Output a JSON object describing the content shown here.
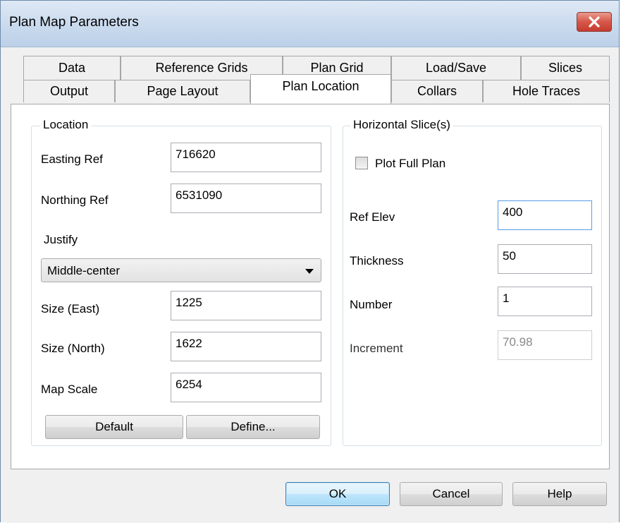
{
  "window": {
    "title": "Plan Map Parameters",
    "close_icon": "close-icon"
  },
  "tabs": {
    "row1": [
      "Data",
      "Reference Grids",
      "Plan Grid",
      "Load/Save",
      "Slices"
    ],
    "row2": [
      "Output",
      "Page Layout",
      "Plan Location",
      "Collars",
      "Hole Traces"
    ],
    "active": "Plan Location"
  },
  "location": {
    "group_title": "Location",
    "easting_label": "Easting Ref",
    "easting_value": "716620",
    "northing_label": "Northing Ref",
    "northing_value": "6531090",
    "justify_label": "Justify",
    "justify_value": "Middle-center",
    "size_east_label": "Size (East)",
    "size_east_value": "1225",
    "size_north_label": "Size (North)",
    "size_north_value": "1622",
    "map_scale_label": "Map Scale",
    "map_scale_value": "6254",
    "default_button": "Default",
    "define_button": "Define..."
  },
  "slices": {
    "group_title": "Horizontal Slice(s)",
    "plot_full_plan_label": "Plot Full Plan",
    "plot_full_plan_checked": false,
    "ref_elev_label": "Ref Elev",
    "ref_elev_value": "400",
    "thickness_label": "Thickness",
    "thickness_value": "50",
    "number_label": "Number",
    "number_value": "1",
    "increment_label": "Increment",
    "increment_value": "70.98"
  },
  "footer": {
    "ok": "OK",
    "cancel": "Cancel",
    "help": "Help"
  }
}
